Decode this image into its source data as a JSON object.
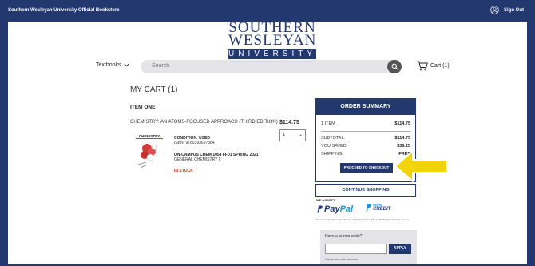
{
  "topbar": {
    "title": "Southern Wesleyan University Official Bookstore",
    "signout": "Sign Out"
  },
  "logo": {
    "line1": "SOUTHERN",
    "line2": "WESLEYAN",
    "line3": "UNIVERSITY"
  },
  "nav": {
    "textbooks": "Textbooks",
    "search_placeholder": "Search",
    "cart": "Cart (1)"
  },
  "cart": {
    "heading": "MY CART (1)",
    "item_header": "ITEM ONE",
    "book_title": "CHEMISTRY: AN ATOMS-FOCUSED APPROACH (THIRD EDITION)",
    "price": "$114.75",
    "qty": "1",
    "cover_title": "CHEMISTRY",
    "condition": "CONDITION: USED",
    "isbn": "ISBN: 9780393697384",
    "course": "ON-CAMPUS CHEM 1054 FF01 SPRING 2021",
    "course_name": "GENERAL CHEMISTRY II",
    "stock": "IN STOCK"
  },
  "summary": {
    "title": "ORDER SUMMARY",
    "items_label": "1 ITEM",
    "items_value": "$114.75",
    "subtotal_label": "SUBTOTAL:",
    "subtotal_value": "$114.75",
    "saved_label": "YOU SAVED:",
    "saved_value": "$38.25",
    "shipping_label": "SHIPPING:",
    "shipping_value": "FREE",
    "checkout": "PROCEED TO CHECKOUT"
  },
  "continue": "CONTINUE SHOPPING",
  "payment": {
    "we_accept": "WE ACCEPT",
    "paypal_a": "Pay",
    "paypal_b": "Pal",
    "credit_small": "PayPal",
    "credit": "CREDIT",
    "fine": "No interest if paid in full within 6 months (on orders $99+) with PayPal credit. See terms."
  },
  "promo": {
    "label": "Have a promo code?",
    "apply": "APPLY",
    "note": "One promo code per order."
  },
  "colors": {
    "brand": "#243870",
    "arrow": "#f1d40a",
    "stock": "#c0392b"
  }
}
